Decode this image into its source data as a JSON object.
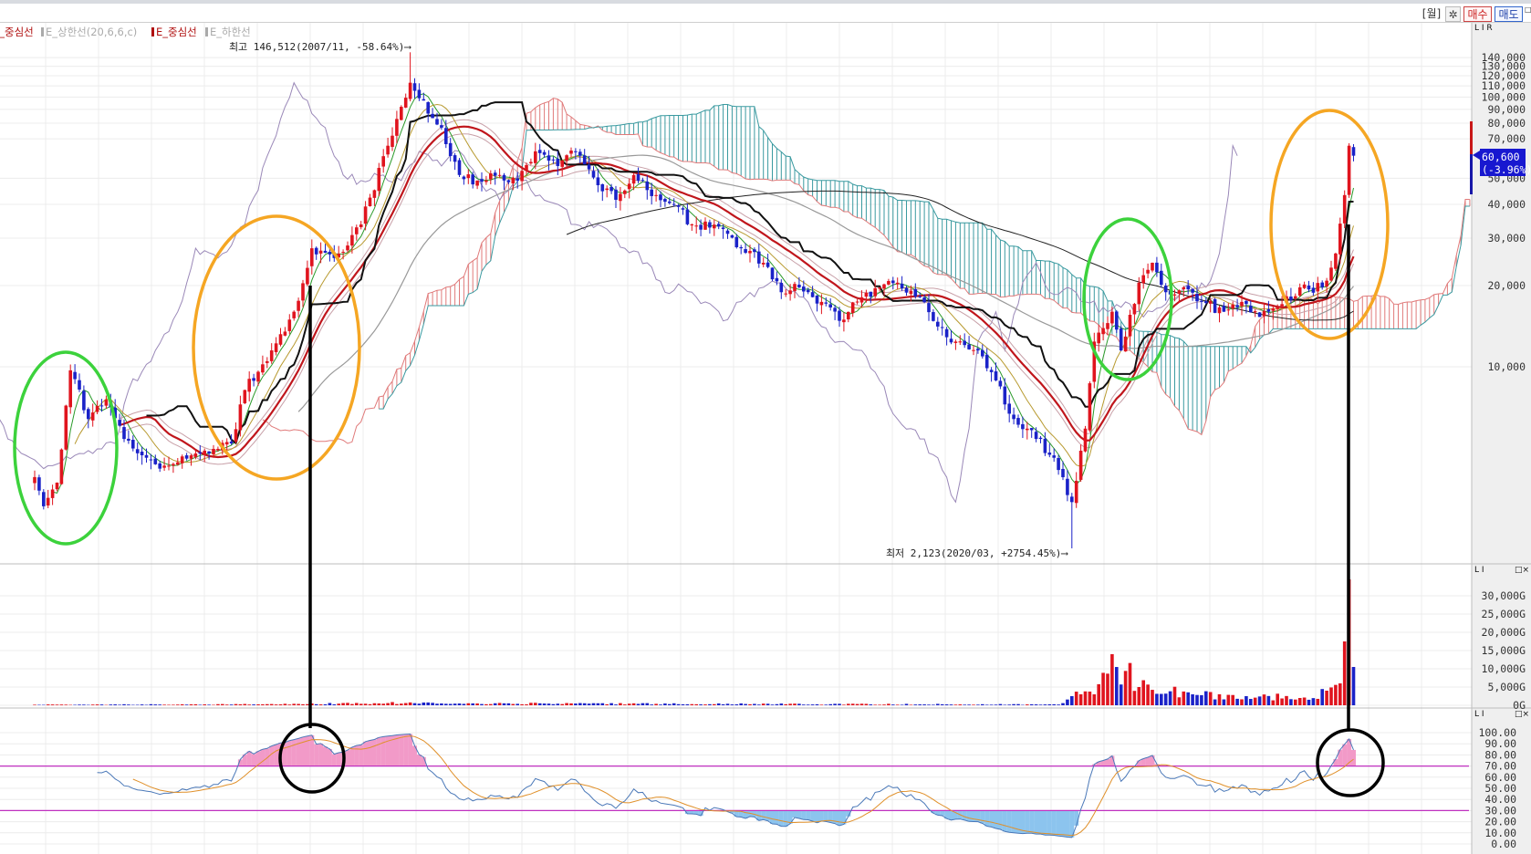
{
  "toolbar": {
    "period": "[월]",
    "settings_icon": "gear-icon",
    "buy_label": "매수",
    "sell_label": "매도",
    "window_icon": "□×"
  },
  "legend": [
    {
      "label": "E_중심선",
      "color": "#b01010"
    },
    {
      "label": "E_상한선(20,6,6,c)",
      "color": "#a8a8a8"
    },
    {
      "label": "E_중심선",
      "color": "#b01010"
    },
    {
      "label": "E_하한선",
      "color": "#a8a8a8"
    }
  ],
  "panel_controls": {
    "price": "L I R",
    "volume": "L I",
    "rsi": "L I",
    "close_icon": "□×"
  },
  "chart_data": {
    "type": "candlestick",
    "interval": "monthly",
    "start": "2000-11",
    "price_scale": "log",
    "price_anchors": [
      [
        "2000-11",
        3900
      ],
      [
        "2001-01",
        3040
      ],
      [
        "2001-04",
        3720
      ],
      [
        "2001-07",
        9700
      ],
      [
        "2001-08",
        9000
      ],
      [
        "2001-11",
        6400
      ],
      [
        "2002-03",
        7550
      ],
      [
        "2002-07",
        5400
      ],
      [
        "2002-12",
        4600
      ],
      [
        "2003-04",
        4300
      ],
      [
        "2003-11",
        4770
      ],
      [
        "2004-07",
        5200
      ],
      [
        "2004-10",
        8200
      ],
      [
        "2005-04",
        11500
      ],
      [
        "2005-09",
        16000
      ],
      [
        "2006-01",
        27500
      ],
      [
        "2006-06",
        25300
      ],
      [
        "2006-12",
        33700
      ],
      [
        "2007-06",
        66000
      ],
      [
        "2007-09",
        92000
      ],
      [
        "2007-11",
        113000
      ],
      [
        "2008-01",
        99000
      ],
      [
        "2008-06",
        77000
      ],
      [
        "2008-10",
        51400
      ],
      [
        "2009-02",
        49000
      ],
      [
        "2009-07",
        51400
      ],
      [
        "2009-11",
        49000
      ],
      [
        "2010-03",
        62900
      ],
      [
        "2010-08",
        55500
      ],
      [
        "2010-12",
        62900
      ],
      [
        "2011-05",
        47100
      ],
      [
        "2011-09",
        41600
      ],
      [
        "2012-01",
        51400
      ],
      [
        "2012-06",
        43300
      ],
      [
        "2012-10",
        40000
      ],
      [
        "2013-02",
        33700
      ],
      [
        "2013-09",
        32400
      ],
      [
        "2014-01",
        27500
      ],
      [
        "2014-06",
        24300
      ],
      [
        "2014-10",
        18900
      ],
      [
        "2015-02",
        19700
      ],
      [
        "2015-07",
        17400
      ],
      [
        "2015-11",
        14800
      ],
      [
        "2016-04",
        18100
      ],
      [
        "2016-08",
        19700
      ],
      [
        "2016-12",
        20500
      ],
      [
        "2017-05",
        18100
      ],
      [
        "2017-09",
        14100
      ],
      [
        "2018-01",
        12400
      ],
      [
        "2018-06",
        11500
      ],
      [
        "2018-10",
        8900
      ],
      [
        "2019-02",
        6400
      ],
      [
        "2019-07",
        5400
      ],
      [
        "2019-11",
        4600
      ],
      [
        "2020-03",
        3150
      ],
      [
        "2020-06",
        5900
      ],
      [
        "2020-08",
        12400
      ],
      [
        "2020-12",
        16000
      ],
      [
        "2021-02",
        11500
      ],
      [
        "2021-06",
        20500
      ],
      [
        "2021-09",
        24300
      ],
      [
        "2021-12",
        18900
      ],
      [
        "2022-04",
        19700
      ],
      [
        "2022-08",
        17400
      ],
      [
        "2023-01",
        16000
      ],
      [
        "2023-05",
        17400
      ],
      [
        "2023-09",
        15300
      ],
      [
        "2024-01",
        16600
      ],
      [
        "2024-06",
        19700
      ],
      [
        "2024-11",
        19700
      ],
      [
        "2025-02",
        26300
      ],
      [
        "2025-04",
        43300
      ],
      [
        "2025-05",
        66000
      ],
      [
        "2025-06",
        60600
      ]
    ],
    "volume_anchors_G": [
      [
        "2000-11",
        150
      ],
      [
        "2005-01",
        250
      ],
      [
        "2007-06",
        600
      ],
      [
        "2008-06",
        500
      ],
      [
        "2019-12",
        200
      ],
      [
        "2020-03",
        2500
      ],
      [
        "2020-08",
        3000
      ],
      [
        "2020-12",
        14000
      ],
      [
        "2021-06",
        5000
      ],
      [
        "2022-06",
        3000
      ],
      [
        "2023-06",
        2500
      ],
      [
        "2024-06",
        2000
      ],
      [
        "2024-12",
        4000
      ],
      [
        "2025-03",
        6000
      ],
      [
        "2025-04",
        17500
      ],
      [
        "2025-05",
        34500
      ],
      [
        "2025-06",
        10500
      ]
    ],
    "high": {
      "date": "2007-11",
      "value": 146512,
      "label": "최고 146,512(2007/11, -58.64%)⟶"
    },
    "low": {
      "date": "2020-03",
      "value": 2123,
      "label": "최저 2,123(2020/03, +2754.45%)⟶"
    },
    "current": {
      "price": "60,600",
      "change": "(-3.96%)"
    },
    "price_ticks": [
      140000,
      130000,
      120000,
      110000,
      100000,
      90000,
      80000,
      70000,
      50000,
      40000,
      30000,
      20000,
      10000
    ],
    "price_tick_labels": [
      "140,000",
      "130,000",
      "120,000",
      "110,000",
      "100,000",
      "90,000",
      "80,000",
      "70,000",
      "50,000",
      "40,000",
      "30,000",
      "20,000",
      "10,000"
    ],
    "volume_ticks": [
      30000,
      25000,
      20000,
      15000,
      10000,
      5000,
      0
    ],
    "volume_tick_labels": [
      "30,000G",
      "25,000G",
      "20,000G",
      "15,000G",
      "10,000G",
      "5,000G",
      "0G"
    ],
    "rsi_ticks": [
      100,
      90,
      80,
      70,
      60,
      50,
      40,
      30,
      20,
      10,
      0
    ],
    "rsi_tick_labels": [
      "100.00",
      "90.00",
      "80.00",
      "70.00",
      "60.00",
      "50.00",
      "40.00",
      "30.00",
      "20.00",
      "10.00",
      "0.00"
    ],
    "rsi_levels": [
      70,
      30
    ],
    "envelope": {
      "period": 20,
      "percent": 6
    },
    "colors": {
      "up": "#e0141e",
      "down": "#1a22c8",
      "ma20": "#c0161c",
      "kijun": "#111111",
      "cloud_up": "#e07a7a",
      "cloud_down": "#3a9aa0",
      "chikou": "#9a88b8",
      "rsi": "#4a78b8",
      "signal": "#e0902a",
      "level": "#c030c0"
    }
  }
}
